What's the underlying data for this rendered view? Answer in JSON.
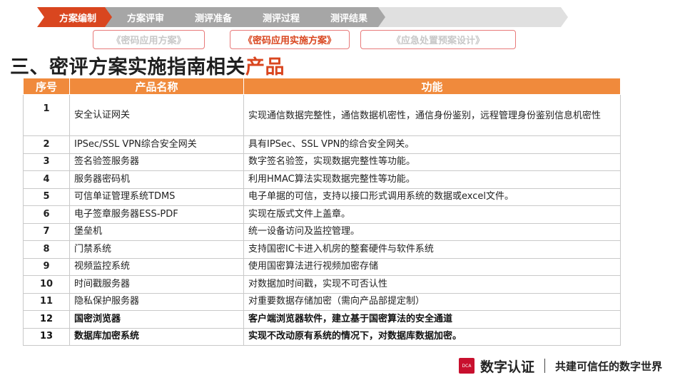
{
  "nav": {
    "steps": [
      "方案编制",
      "方案评审",
      "测评准备",
      "测评过程",
      "测评结果"
    ],
    "active_index": 0
  },
  "subtabs": [
    "《密码应用方案》",
    "《密码应用实施方案》",
    "《应急处置预案设计》"
  ],
  "title": {
    "main": "三、密评方案实施指南相关",
    "accent": "产品"
  },
  "table": {
    "headers": [
      "序号",
      "产品名称",
      "功能"
    ],
    "rows": [
      {
        "no": "1",
        "name": "安全认证网关",
        "func": "实现通信数据完整性，通信数据机密性，通信身份鉴别，远程管理身份鉴别信息机密性"
      },
      {
        "no": "2",
        "name": "IPSec/SSL VPN综合安全网关",
        "func": "具有IPSec、SSL VPN的综合安全网关。"
      },
      {
        "no": "3",
        "name": "签名验签服务器",
        "func": "数字签名验签，实现数据完整性等功能。"
      },
      {
        "no": "4",
        "name": "服务器密码机",
        "func": "利用HMAC算法实现数据完整性等功能。"
      },
      {
        "no": "5",
        "name": "可信单证管理系统TDMS",
        "func": "电子单据的可信，支持以接口形式调用系统的数据或excel文件。"
      },
      {
        "no": "6",
        "name": "电子签章服务器ESS-PDF",
        "func": "实现在版式文件上盖章。"
      },
      {
        "no": "7",
        "name": "堡垒机",
        "func": "统一设备访问及监控管理。"
      },
      {
        "no": "8",
        "name": "门禁系统",
        "func": "支持国密IC卡进入机房的整套硬件与软件系统"
      },
      {
        "no": "9",
        "name": "视频监控系统",
        "func": "使用国密算法进行视频加密存储"
      },
      {
        "no": "10",
        "name": "时间戳服务器",
        "func": "对数据加时间戳，实现不可否认性"
      },
      {
        "no": "11",
        "name": "隐私保护服务器",
        "func": "对重要数据存储加密（需向产品部提定制）"
      },
      {
        "no": "12",
        "name": "国密浏览器",
        "func": "客户端浏览器软件，建立基于国密算法的安全通道"
      },
      {
        "no": "13",
        "name": "数据库加密系统",
        "func": "实现不改动原有系统的情况下，对数据库数据加密。"
      }
    ]
  },
  "brand": {
    "logo_text": "DCA",
    "name": "数字认证",
    "slogan": "共建可信任的数字世界"
  },
  "colors": {
    "accent": "#d9461f",
    "header_orange": "#f08a3c",
    "inactive_step": "#a6a6a6",
    "logo_red": "#c8102e"
  }
}
